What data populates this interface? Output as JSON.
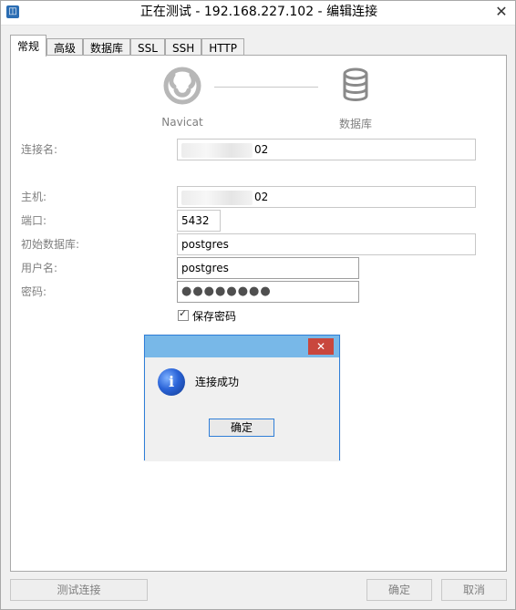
{
  "window": {
    "title": "正在测试 - 192.168.227.102 - 编辑连接",
    "close_label": "✕"
  },
  "tabs": [
    {
      "label": "常规",
      "active": true
    },
    {
      "label": "高级",
      "active": false
    },
    {
      "label": "数据库",
      "active": false
    },
    {
      "label": "SSL",
      "active": false
    },
    {
      "label": "SSH",
      "active": false
    },
    {
      "label": "HTTP",
      "active": false
    }
  ],
  "header": {
    "left_label": "Navicat",
    "right_label": "数据库"
  },
  "form": {
    "connection_name": {
      "label": "连接名:",
      "value_suffix": "02"
    },
    "host": {
      "label": "主机:",
      "value_suffix": "02"
    },
    "port": {
      "label": "端口:",
      "value": "5432"
    },
    "initial_database": {
      "label": "初始数据库:",
      "value": "postgres"
    },
    "username": {
      "label": "用户名:",
      "value": "postgres"
    },
    "password": {
      "label": "密码:",
      "value": "●●●●●●●●"
    },
    "save_password": {
      "label": "保存密码",
      "checked": true
    }
  },
  "modal": {
    "message": "连接成功",
    "ok_label": "确定",
    "close_label": "✕"
  },
  "buttons": {
    "test_connection": "测试连接",
    "ok": "确定",
    "cancel": "取消"
  }
}
